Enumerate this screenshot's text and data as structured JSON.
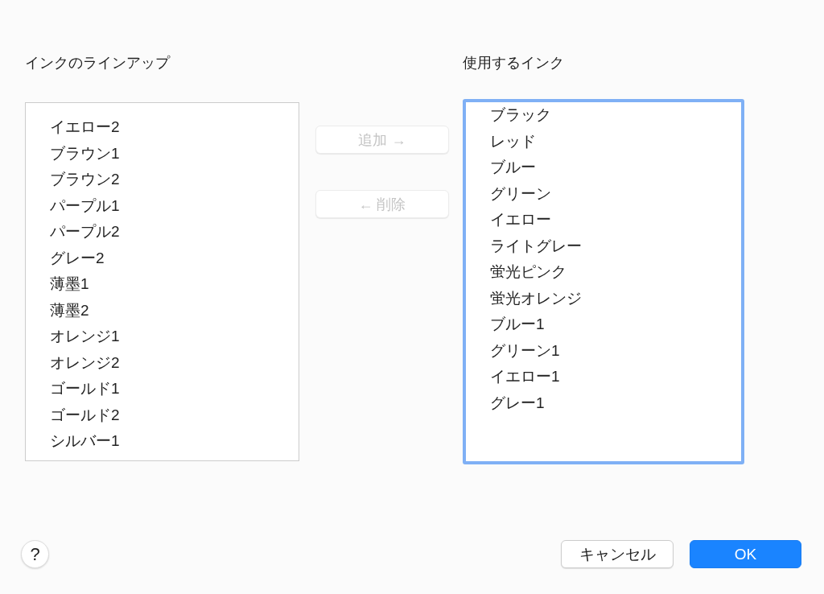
{
  "lineup": {
    "label": "インクのラインアップ",
    "items": [
      "イエロー2",
      "ブラウン1",
      "ブラウン2",
      "パープル1",
      "パープル2",
      "グレー2",
      "薄墨1",
      "薄墨2",
      "オレンジ1",
      "オレンジ2",
      "ゴールド1",
      "ゴールド2",
      "シルバー1"
    ],
    "focused": false
  },
  "transfer_buttons": [
    {
      "label": "追加 →",
      "disabled": true
    },
    {
      "label": "← 削除",
      "disabled": true
    }
  ],
  "used": {
    "label": "使用するインク",
    "items": [
      "ブラック",
      "レッド",
      "ブルー",
      "グリーン",
      "イエロー",
      "ライトグレー",
      "蛍光ピンク",
      "蛍光オレンジ",
      "ブルー1",
      "グリーン1",
      "イエロー1",
      "グレー1"
    ],
    "focused": true
  },
  "help_button": {
    "label": "?"
  },
  "buttons": [
    {
      "label": "キャンセル",
      "kind": "secondary"
    },
    {
      "label": "OK",
      "kind": "primary"
    }
  ]
}
